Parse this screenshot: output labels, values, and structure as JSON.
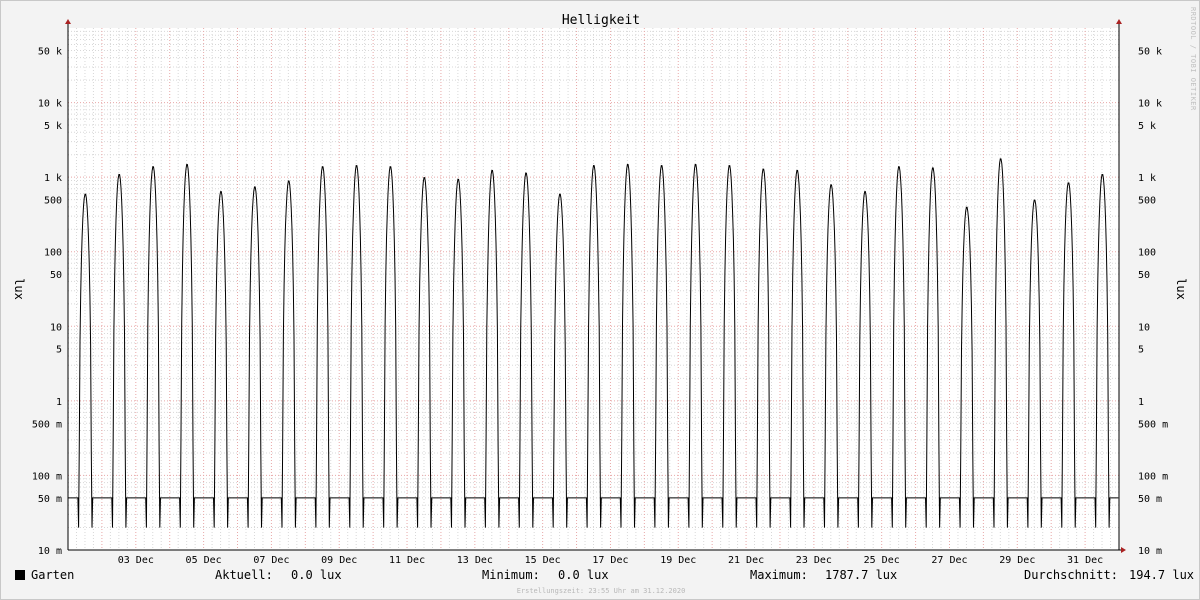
{
  "chart_data": {
    "type": "line",
    "title": "Helligkeit",
    "ylabel": "lux",
    "y_scale": "log",
    "ylim": [
      0.01,
      100000
    ],
    "ytick_labels": [
      {
        "value": 50000,
        "label": "50 k"
      },
      {
        "value": 10000,
        "label": "10 k"
      },
      {
        "value": 5000,
        "label": "5 k"
      },
      {
        "value": 1000,
        "label": "1 k"
      },
      {
        "value": 500,
        "label": "500"
      },
      {
        "value": 100,
        "label": "100"
      },
      {
        "value": 50,
        "label": "50"
      },
      {
        "value": 10,
        "label": "10"
      },
      {
        "value": 5,
        "label": "5"
      },
      {
        "value": 1,
        "label": "1"
      },
      {
        "value": 0.5,
        "label": "500 m"
      },
      {
        "value": 0.1,
        "label": "100 m"
      },
      {
        "value": 0.05,
        "label": "50 m"
      },
      {
        "value": 0.01,
        "label": "10 m"
      }
    ],
    "x_start": "2020-12-01 00:00",
    "x_end": "2021-01-01 00:00",
    "xtick_labels": [
      "03 Dec",
      "05 Dec",
      "07 Dec",
      "09 Dec",
      "11 Dec",
      "13 Dec",
      "15 Dec",
      "17 Dec",
      "19 Dec",
      "21 Dec",
      "23 Dec",
      "25 Dec",
      "27 Dec",
      "29 Dec",
      "31 Dec"
    ],
    "grid": true,
    "series": [
      {
        "name": "Garten",
        "color": "#000000",
        "daily_peak_lux": [
          600,
          1100,
          1400,
          1500,
          650,
          750,
          900,
          1400,
          1450,
          1400,
          1000,
          950,
          1250,
          1150,
          600,
          1450,
          1500,
          1450,
          1500,
          1450,
          1300,
          1250,
          800,
          650,
          1400,
          1350,
          400,
          1787.7,
          500,
          850,
          1100
        ],
        "night_level_lux": 0.05
      }
    ]
  },
  "legend": {
    "series_name": "Garten",
    "current_label": "Aktuell:",
    "current_value": "0.0 lux",
    "min_label": "Minimum:",
    "min_value": "0.0 lux",
    "max_label": "Maximum:",
    "max_value": "1787.7 lux",
    "avg_label": "Durchschnitt:",
    "avg_value": "194.7 lux"
  },
  "footer": "Erstellungszeit: 23:55 Uhr am 31.12.2020",
  "watermark": "RRDTOOL / TOBI OETIKER",
  "colors": {
    "background": "#f3f3f3",
    "canvas": "#ffffff",
    "major_grid": "#e8a8a8",
    "minor_grid": "#d8d8d8",
    "line": "#000000",
    "axis_arrow": "#aa2222"
  }
}
